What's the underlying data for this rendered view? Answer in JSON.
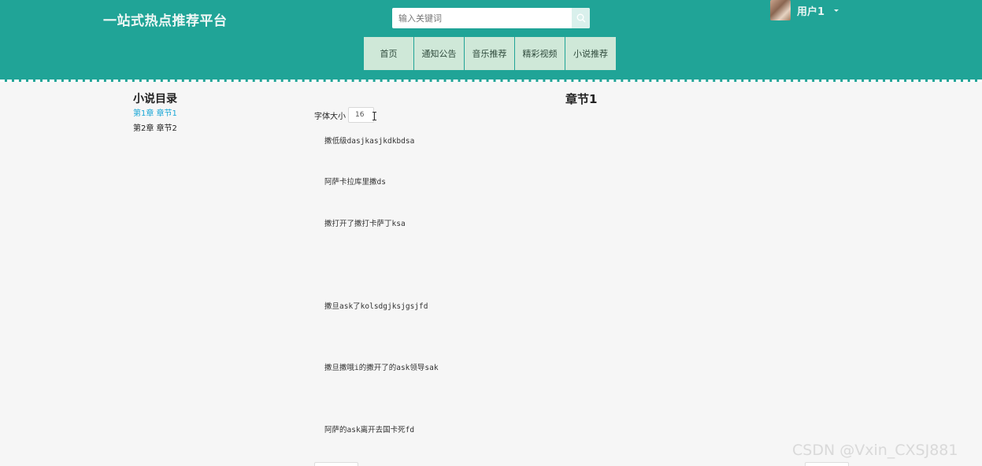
{
  "header": {
    "brand": "一站式热点推荐平台",
    "search": {
      "placeholder": "输入关键词",
      "icon": "search-icon"
    },
    "user": {
      "name": "用户1",
      "icon": "chevron-down-icon"
    }
  },
  "nav": {
    "items": [
      {
        "label": "首页"
      },
      {
        "label": "通知公告"
      },
      {
        "label": "音乐推荐"
      },
      {
        "label": "精彩视频"
      },
      {
        "label": "小说推荐"
      }
    ]
  },
  "toc": {
    "title": "小说目录",
    "items": [
      {
        "label": "第1章 章节1",
        "active": true
      },
      {
        "label": "第2章 章节2",
        "active": false
      }
    ]
  },
  "reader": {
    "chapter_title": "章节1",
    "font_size_label": "字体大小",
    "font_size_value": "16",
    "paragraphs": [
      "撒低级dasjkasjkdkbdsa",
      "阿萨卡拉库里撒ds",
      "撒打开了撒打卡萨丁ksa",
      "撒旦ask了kolsdgjksjgsjfd",
      "撒旦撒哦i的撒开了的ask领导sak",
      "阿萨的ask离开去国卡死fd"
    ]
  },
  "watermark": "CSDN @Vxin_CXSJ881",
  "colors": {
    "header_bg": "#20a497",
    "nav_bg": "#cfe8d8",
    "active_link": "#1aa7d6",
    "page_bg": "#f6f6f6"
  }
}
